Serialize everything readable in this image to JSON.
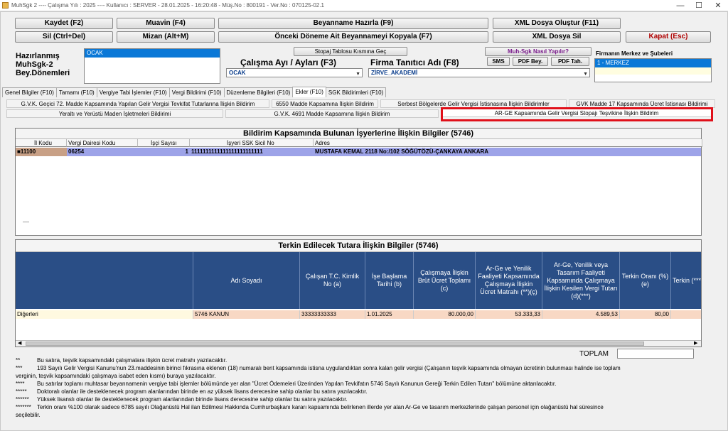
{
  "titlebar": {
    "text": "MuhSgk 2 ---- Çalışma Yılı : 2025 ---- Kullanıcı : SERVER - 28.01.2025 - 16:20:48 - Müş.No : 800191 - Ver.No : 070125-02.1",
    "min": "—",
    "max": "☐",
    "close": "✕"
  },
  "buttons": {
    "kaydet": "Kaydet (F2)",
    "muavin": "Muavin (F4)",
    "beyanname": "Beyanname Hazırla (F9)",
    "xml_olustur": "XML Dosya Oluştur (F11)",
    "sil": "Sil (Ctrl+Del)",
    "mizan": "Mizan (Alt+M)",
    "onceki": "Önceki Döneme Ait Beyannameyi Kopyala (F7)",
    "xml_sil": "XML Dosya Sil",
    "kapat": "Kapat (Esc)",
    "stopaj": "Stopaj Tablosu Kısmına Geç",
    "nasil": "Muh-Sgk Nasıl Yapılır?",
    "sms": "SMS",
    "pdf_bey": "PDF Bey.",
    "pdf_tah": "PDF Tah."
  },
  "left_label": [
    "Hazırlanmış",
    "MuhSgk-2",
    "Bey.Dönemleri"
  ],
  "period_list": [
    "OCAK"
  ],
  "calisma_label": "Çalışma Ayı / Ayları (F3)",
  "calisma_value": "OCAK",
  "firma_label": "Firma Tanıtıcı Adı (F8)",
  "firma_value": "ZİRVE_AKADEMİ",
  "sube_label": "Firmanın Merkez ve Şubeleri",
  "sube_list": [
    "1 - MERKEZ"
  ],
  "tabs": [
    "Genel Bilgiler (F10)",
    "Tamamı (F10)",
    "Vergiye Tabi İşlemler (F10)",
    "Vergi Bildirimi (F10)",
    "Düzenleme Bilgileri (F10)",
    "Ekler (F10)",
    "SGK Bildirimleri (F10)"
  ],
  "subtabs": {
    "r1": [
      "G.V.K. Geçici 72. Madde Kapsamında Yapılan Gelir Vergisi Tevkifat Tutarlarına İlişkin Bildirim",
      "6550 Madde Kapsamına İlişkin Bildirim",
      "Serbest Bölgelerde Gelir Vergisi İstisnasına İlişkin Bildirimler",
      "GVK Madde 17 Kapsamında Ücret İstisnası Bildirimi"
    ],
    "r2": [
      "Yeraltı ve Yerüstü Maden İşletmeleri Bildirimi",
      "G.V.K. 4691 Madde Kapsamına İlişkin Bildirim",
      "AR-GE Kapsamında Gelir Vergisi Stopajı Teşvikine İlişkin Bildirim"
    ]
  },
  "top_grid": {
    "title": "Bildirim Kapsamında  Bulunan İşyerlerine İlişkin Bilgiler (5746)",
    "headers": [
      "İl Kodu",
      "Vergi Dairesi Kodu",
      "İşçi Sayısı",
      "İşyeri SSK Sicil No",
      "Adres"
    ],
    "row": [
      "11100",
      "06254",
      "1",
      "1111111111111111111111111",
      "MUSTAFA KEMAL  2118 No:/102 SÖĞÜTÖZÜ-ÇANKAYA ANKARA"
    ]
  },
  "bottom_grid": {
    "title": "Terkin Edilecek Tutara İlişkin Bilgiler (5746)",
    "headers": [
      "Adı Soyadı",
      "Çalışan T.C. Kimlik No (a)",
      "İşe Başlama Tarihi (b)",
      "Çalışmaya İlişkin Brüt Ücret Toplamı (c)",
      "Ar-Ge ve Yenilik Faaliyeti Kapsamında Çalışmaya İlişkin Ücret Matrahı (**)(ç)",
      "Ar-Ge, Yenilik veya Tasarım Faaliyeti Kapsamında Çalışmaya İlişkin Kesilen Vergi Tutarı (d)(***)",
      "Terkin Oranı (%) (e)",
      "Terkin (****"
    ],
    "row": [
      "Diğerleri",
      "5746 KANUN",
      "33333333333",
      "1.01.2025",
      "80.000,00",
      "53.333,33",
      "4.589,53",
      "80,00"
    ]
  },
  "toplam_label": "TOPLAM",
  "notes": [
    {
      "mark": "**",
      "text": "Bu satıra, teşvik kapsamındaki çalışmalara ilişkin ücret matrahı yazılacaktır."
    },
    {
      "mark": "***",
      "text": "193 Sayılı Gelir Vergisi Kanunu'nun 23.maddesinin birinci fıkrasına eklenen (18) numaralı bent kapsamında istisna uygulandıktan sonra kalan gelir vergisi (Çalışanın teşvik kapsamında olmayan ücretinin bulunması halinde ise toplam"
    },
    {
      "mark": "",
      "text": "verginin, teşvik kapsamındaki çalışmaya isabet eden kısmı) buraya yazılacaktır."
    },
    {
      "mark": "****",
      "text": "Bu satırlar toplamı muhtasar beyannamenin vergiye tabi işlemler bölümünde yer alan \"Ücret Ödemeleri Üzerinden Yapılan Tevkifatın 5746 Sayılı Kanunun Gereği Terkin Edilen Tutarı\" bölümüne aktarılacaktır."
    },
    {
      "mark": "*****",
      "text": "Doktoralı olanlar ile desteklenecek program alanlarından birinde en az yüksek lisans derecesine sahip olanlar bu satıra yazılacaktır."
    },
    {
      "mark": "******",
      "text": "Yüksek lisanslı olanlar ile desteklenecek program alanlarından birinde lisans derecesine sahip olanlar bu satıra yazılacaktır."
    },
    {
      "mark": "*******",
      "text": "Terkin oranı %100 olarak sadece 6785 sayılı Olağanüstü Hal ilan Edilmesi Hakkında Cumhurbaşkanı kararı kapsamında belirlenen illerde yer alan Ar-Ge ve tasarım merkezlerinde çalışan personel için olağanüstü hal süresince"
    },
    {
      "mark": "",
      "text": "seçilebilir."
    }
  ],
  "colors": {
    "accent": "#0a78d7",
    "header_blue": "#2a4e86",
    "row_purple": "#9da3e8",
    "row_peach": "#f8d8c4",
    "highlight": "#e0101a"
  }
}
